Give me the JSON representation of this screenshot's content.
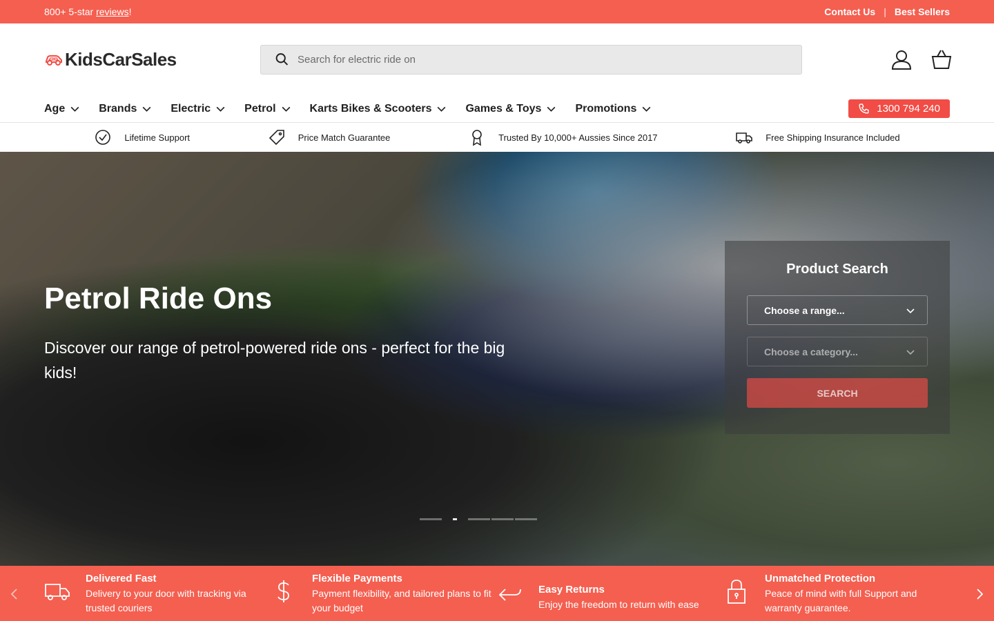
{
  "announcement": {
    "reviews_prefix": "800+ 5-star ",
    "reviews_link": "reviews",
    "reviews_suffix": "!",
    "contact": "Contact Us",
    "separator": "|",
    "best_sellers": "Best Sellers"
  },
  "header": {
    "logo_text": "KidsCarSales",
    "search_placeholder": "Search for electric ride on"
  },
  "nav": {
    "items": [
      "Age",
      "Brands",
      "Electric",
      "Petrol",
      "Karts Bikes & Scooters",
      "Games & Toys",
      "Promotions"
    ],
    "phone": "1300 794 240"
  },
  "usp": {
    "items": [
      {
        "label": "Lifetime Support",
        "icon": "check-circle-icon"
      },
      {
        "label": "Price Match Guarantee",
        "icon": "tag-icon"
      },
      {
        "label": "Trusted By 10,000+ Aussies Since 2017",
        "icon": "award-icon"
      },
      {
        "label": "Free Shipping Insurance Included",
        "icon": "truck-icon"
      }
    ]
  },
  "hero": {
    "title": "Petrol Ride Ons",
    "subtitle": "Discover our range of petrol-powered ride ons - perfect for the big kids!",
    "slides_total": 5,
    "active_slide": 2
  },
  "product_search": {
    "title": "Product Search",
    "range_placeholder": "Choose a range...",
    "category_placeholder": "Choose a category...",
    "button": "SEARCH"
  },
  "features": [
    {
      "title": "Delivered Fast",
      "desc": "Delivery to your door with tracking via trusted couriers",
      "icon": "truck-icon"
    },
    {
      "title": "Flexible Payments",
      "desc": "Payment flexibility, and tailored plans to fit your budget",
      "icon": "dollar-icon"
    },
    {
      "title": "Easy Returns",
      "desc": "Enjoy the freedom to return with ease",
      "icon": "return-arrow-icon"
    },
    {
      "title": "Unmatched Protection",
      "desc": "Peace of mind with full Support and warranty guarantee.",
      "icon": "lock-icon"
    }
  ],
  "colors": {
    "brand_red": "#f45f50",
    "button_red": "#f14c45"
  }
}
